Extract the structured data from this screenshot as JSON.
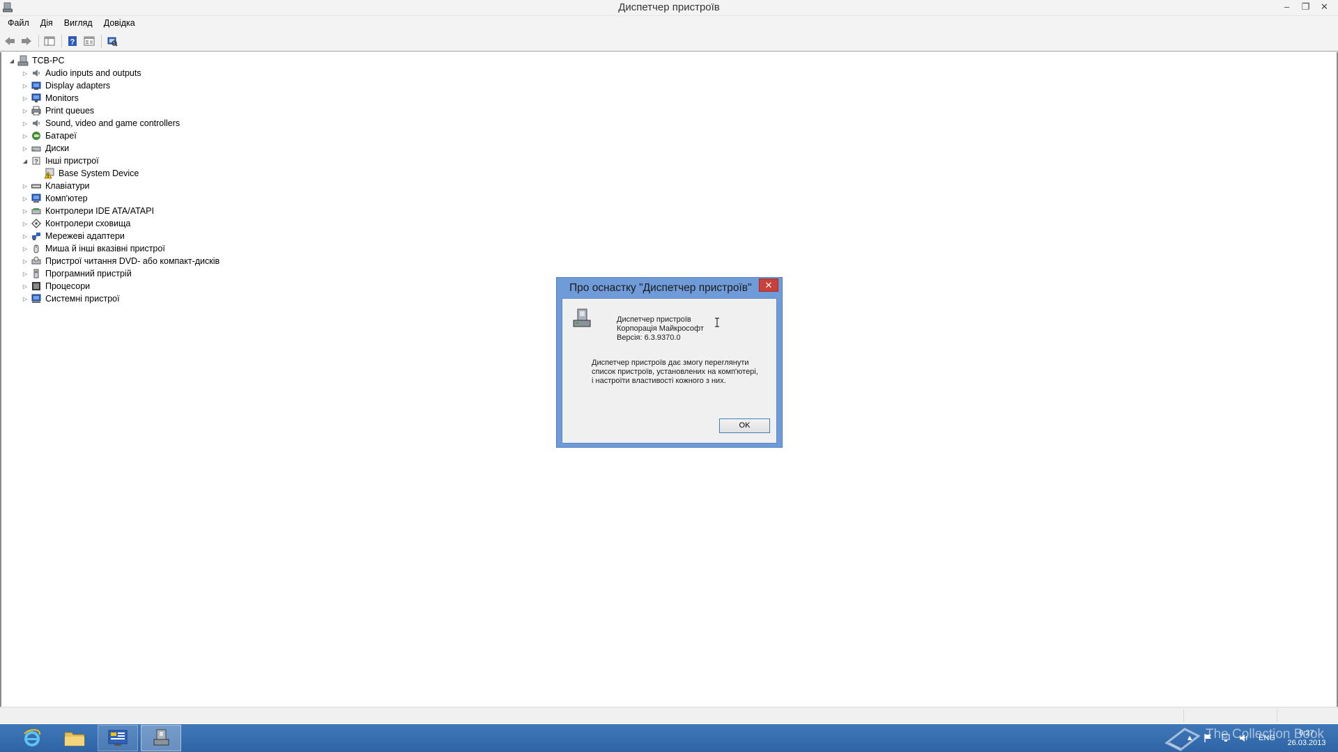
{
  "window": {
    "title": "Диспетчер пристроїв",
    "controls": {
      "minimize": "‒",
      "restore": "❐",
      "close": "✕"
    }
  },
  "menu": [
    "Файл",
    "Дія",
    "Вигляд",
    "Довідка"
  ],
  "toolbar": {
    "icons": [
      "back-arrow-icon",
      "forward-arrow-icon",
      "show-hide-console-tree-icon",
      "help-icon",
      "properties-icon",
      "scan-hardware-icon"
    ]
  },
  "tree": {
    "root": "TCB-PC",
    "categories": [
      {
        "label": "Audio inputs and outputs",
        "icon": "speaker-icon",
        "expanded": false
      },
      {
        "label": "Display adapters",
        "icon": "display-adapter-icon",
        "expanded": false
      },
      {
        "label": "Monitors",
        "icon": "monitor-icon",
        "expanded": false
      },
      {
        "label": "Print queues",
        "icon": "printer-icon",
        "expanded": false
      },
      {
        "label": "Sound, video and game controllers",
        "icon": "speaker-icon",
        "expanded": false
      },
      {
        "label": "Батареї",
        "icon": "battery-icon",
        "expanded": false
      },
      {
        "label": "Диски",
        "icon": "disk-drive-icon",
        "expanded": false
      },
      {
        "label": "Інші пристрої",
        "icon": "unknown-device-icon",
        "expanded": true,
        "children": [
          "Base System Device"
        ]
      },
      {
        "label": "Клавіатури",
        "icon": "keyboard-icon",
        "expanded": false
      },
      {
        "label": "Комп'ютер",
        "icon": "computer-icon",
        "expanded": false
      },
      {
        "label": "Контролери IDE ATA/ATAPI",
        "icon": "ide-controller-icon",
        "expanded": false
      },
      {
        "label": "Контролери сховища",
        "icon": "storage-controller-icon",
        "expanded": false
      },
      {
        "label": "Мережеві адаптери",
        "icon": "network-adapter-icon",
        "expanded": false
      },
      {
        "label": "Миша й інші вказівні пристрої",
        "icon": "mouse-icon",
        "expanded": false
      },
      {
        "label": "Пристрої читання DVD- або компакт-дисків",
        "icon": "dvd-drive-icon",
        "expanded": false
      },
      {
        "label": "Програмний пристрій",
        "icon": "software-device-icon",
        "expanded": false
      },
      {
        "label": "Процесори",
        "icon": "processor-icon",
        "expanded": false
      },
      {
        "label": "Системні пристрої",
        "icon": "system-devices-icon",
        "expanded": false
      }
    ]
  },
  "dialog": {
    "title": "Про оснастку \"Диспетчер пристроїв\"",
    "close": "✕",
    "product": "Диспетчер пристроїв",
    "company": "Корпорація Майкрософт",
    "version": "Версія: 6.3.9370.0",
    "description_line1": "Диспетчер пристроїв дає змогу переглянути",
    "description_line2": "список пристроїв, установлених на комп'ютері,",
    "description_line3": "і настроїти властивості кожного з них.",
    "ok": "OK"
  },
  "taskbar": {
    "apps": [
      "internet-explorer-icon",
      "file-explorer-icon",
      "control-panel-icon",
      "device-manager-icon"
    ],
    "language": "ENG",
    "time": "9:27",
    "date": "26.03.2013"
  },
  "watermark": "The Collection Book",
  "colors": {
    "taskbar": "#3a70b2",
    "dialog_frame": "#6f9bd8",
    "close_button": "#c8413a"
  }
}
